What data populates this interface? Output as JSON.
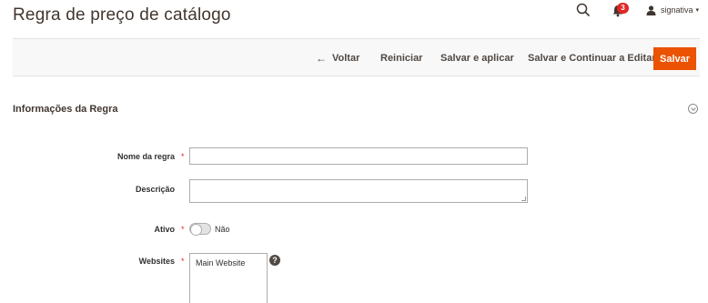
{
  "page": {
    "title": "Regra de preço de catálogo"
  },
  "header": {
    "notifications_count": "3",
    "user_name": "signativa",
    "user_caret": "▾"
  },
  "actions": {
    "back_arrow": "←",
    "back_label": "Voltar",
    "reset_label": "Reiniciar",
    "save_apply_label": "Salvar e aplicar",
    "save_continue_label": "Salvar e Continuar a Editar",
    "save_label": "Salvar"
  },
  "section": {
    "title": "Informações da Regra"
  },
  "form": {
    "name_label": "Nome da regra",
    "name_value": "",
    "description_label": "Descrição",
    "description_value": "",
    "active_label": "Ativo",
    "active_state": "Não",
    "websites_label": "Websites",
    "websites_options": [
      "Main Website"
    ],
    "required_mark": "*",
    "help_glyph": "?"
  },
  "colors": {
    "accent": "#eb5202",
    "badge": "#e22626",
    "required": "#e22626"
  },
  "icons": {
    "search": "search-icon",
    "notifications": "bell-icon",
    "user": "user-icon",
    "collapse": "chevron-up-circle-icon",
    "help": "help-icon"
  }
}
